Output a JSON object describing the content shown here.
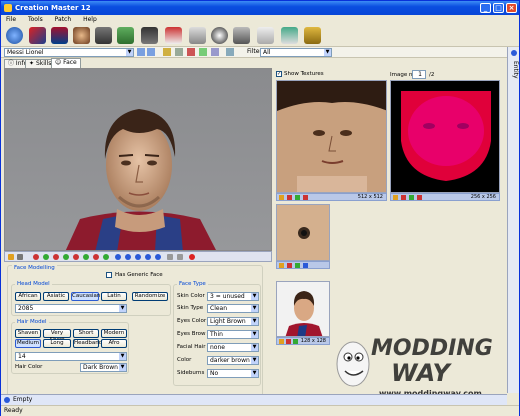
{
  "window": {
    "title": "Creation Master 12"
  },
  "menu": [
    "File",
    "Tools",
    "Patch",
    "Help"
  ],
  "filterbar": {
    "player_select": "Messi Lionel",
    "filter_label": "Filter",
    "filter_value": "All"
  },
  "tabs": [
    {
      "label": "Info"
    },
    {
      "label": "Skills"
    },
    {
      "label": "Face"
    }
  ],
  "face_modelling": {
    "title": "Face Modelling",
    "has_generic_face_label": "Has Generic Face",
    "head_model": {
      "title": "Head Model",
      "buttons": [
        "African",
        "Asiatic",
        "Caucasian",
        "Latin"
      ],
      "selected": "Caucasian",
      "randomize_label": "Randomize",
      "value": "2085"
    },
    "hair_model": {
      "title": "Hair Model",
      "buttons_row1": [
        "Shaven",
        "Very Short",
        "Short",
        "Modern"
      ],
      "buttons_row2": [
        "Medium",
        "Long",
        "Headband",
        "Afro"
      ],
      "selected": "Medium",
      "value": "14",
      "hair_color_label": "Hair Color",
      "hair_color_value": "Dark Brown"
    }
  },
  "face_type": {
    "title": "Face Type",
    "rows": [
      {
        "label": "Skin Color",
        "value": "3 = unused"
      },
      {
        "label": "Skin Type",
        "value": "Clean"
      },
      {
        "label": "Eyes Color",
        "value": "Light Brown"
      },
      {
        "label": "Eyes Brow",
        "value": "Thin"
      },
      {
        "label": "Facial Hair",
        "value": "none"
      },
      {
        "label": "Color",
        "value": "darker brown"
      },
      {
        "label": "Sideburns",
        "value": "No"
      }
    ]
  },
  "textures": {
    "show_textures_label": "Show Textures",
    "image_n_label": "Image n.",
    "image_n_value": "1",
    "image_total": "/2",
    "face_texture_size": "512 x 512",
    "alpha_texture_size": "256 x 256",
    "photo_size": "128 x 128"
  },
  "sidebar": {
    "label": "Entity"
  },
  "bottom_bar": {
    "label": "Empty"
  },
  "status": {
    "text": "Ready"
  },
  "watermark": {
    "brand": "MODDING WAY",
    "url": "www.moddingway.com"
  }
}
